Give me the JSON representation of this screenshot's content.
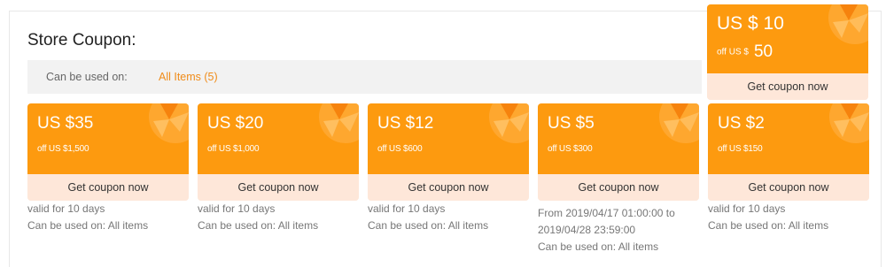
{
  "store": {
    "title": "Store Coupon:",
    "usage_label": "Can be used on:",
    "usage_link": "All Items (5)"
  },
  "featured": {
    "amount": "US $ 10",
    "min_prefix": "off US $",
    "min_value": "50",
    "button": "Get coupon now"
  },
  "coupons": [
    {
      "amount": "US $35",
      "min": "off US $1,500",
      "button": "Get coupon now",
      "info": [
        "valid for 10 days",
        "Can be used on: All items"
      ]
    },
    {
      "amount": "US $20",
      "min": "off US $1,000",
      "button": "Get coupon now",
      "info": [
        "valid for 10 days",
        "Can be used on: All items"
      ]
    },
    {
      "amount": "US $12",
      "min": "off US $600",
      "button": "Get coupon now",
      "info": [
        "valid for 10 days",
        "Can be used on: All items"
      ]
    },
    {
      "amount": "US $5",
      "min": "off US $300",
      "button": "Get coupon now",
      "info": [
        "From 2019/04/17 01:00:00 to",
        "2019/04/28 23:59:00",
        "Can be used on: All items"
      ]
    },
    {
      "amount": "US $2",
      "min": "off US $150",
      "button": "Get coupon now",
      "info": [
        "valid for 10 days",
        "Can be used on: All items"
      ]
    }
  ],
  "colors": {
    "coupon_orange": "#fd9a0f",
    "coupon_light": "#fee7d9",
    "link_orange": "#f08c1a"
  }
}
